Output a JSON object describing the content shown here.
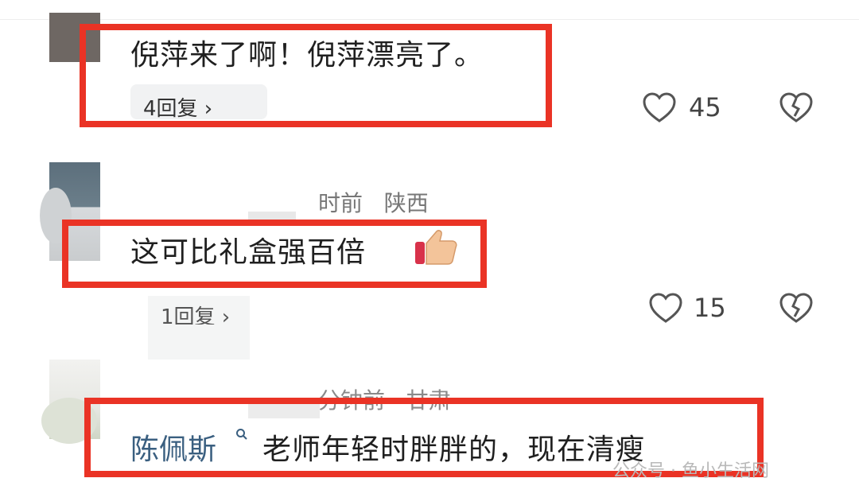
{
  "comments": [
    {
      "text": "倪萍来了啊！倪萍漂亮了。",
      "reply_label": "4回复 ›",
      "likes": "45"
    },
    {
      "meta_time": "时前",
      "meta_region": "陕西",
      "text": "这可比礼盒强百倍",
      "reply_label": "1回复 ›",
      "likes": "15"
    },
    {
      "meta_time": "分钟前",
      "meta_region": "甘肃",
      "username": "陈佩斯",
      "text": "老师年轻时胖胖的，现在清瘦"
    }
  ],
  "watermark": "公众号 · 鱼小生活网",
  "colors": {
    "highlight_box": "#ea3325",
    "username": "#3a5f80",
    "icon_stroke": "#555555"
  },
  "icons": {
    "like": "heart-outline-icon",
    "dislike": "broken-heart-icon",
    "emoji": "thumbs-up-emoji"
  }
}
